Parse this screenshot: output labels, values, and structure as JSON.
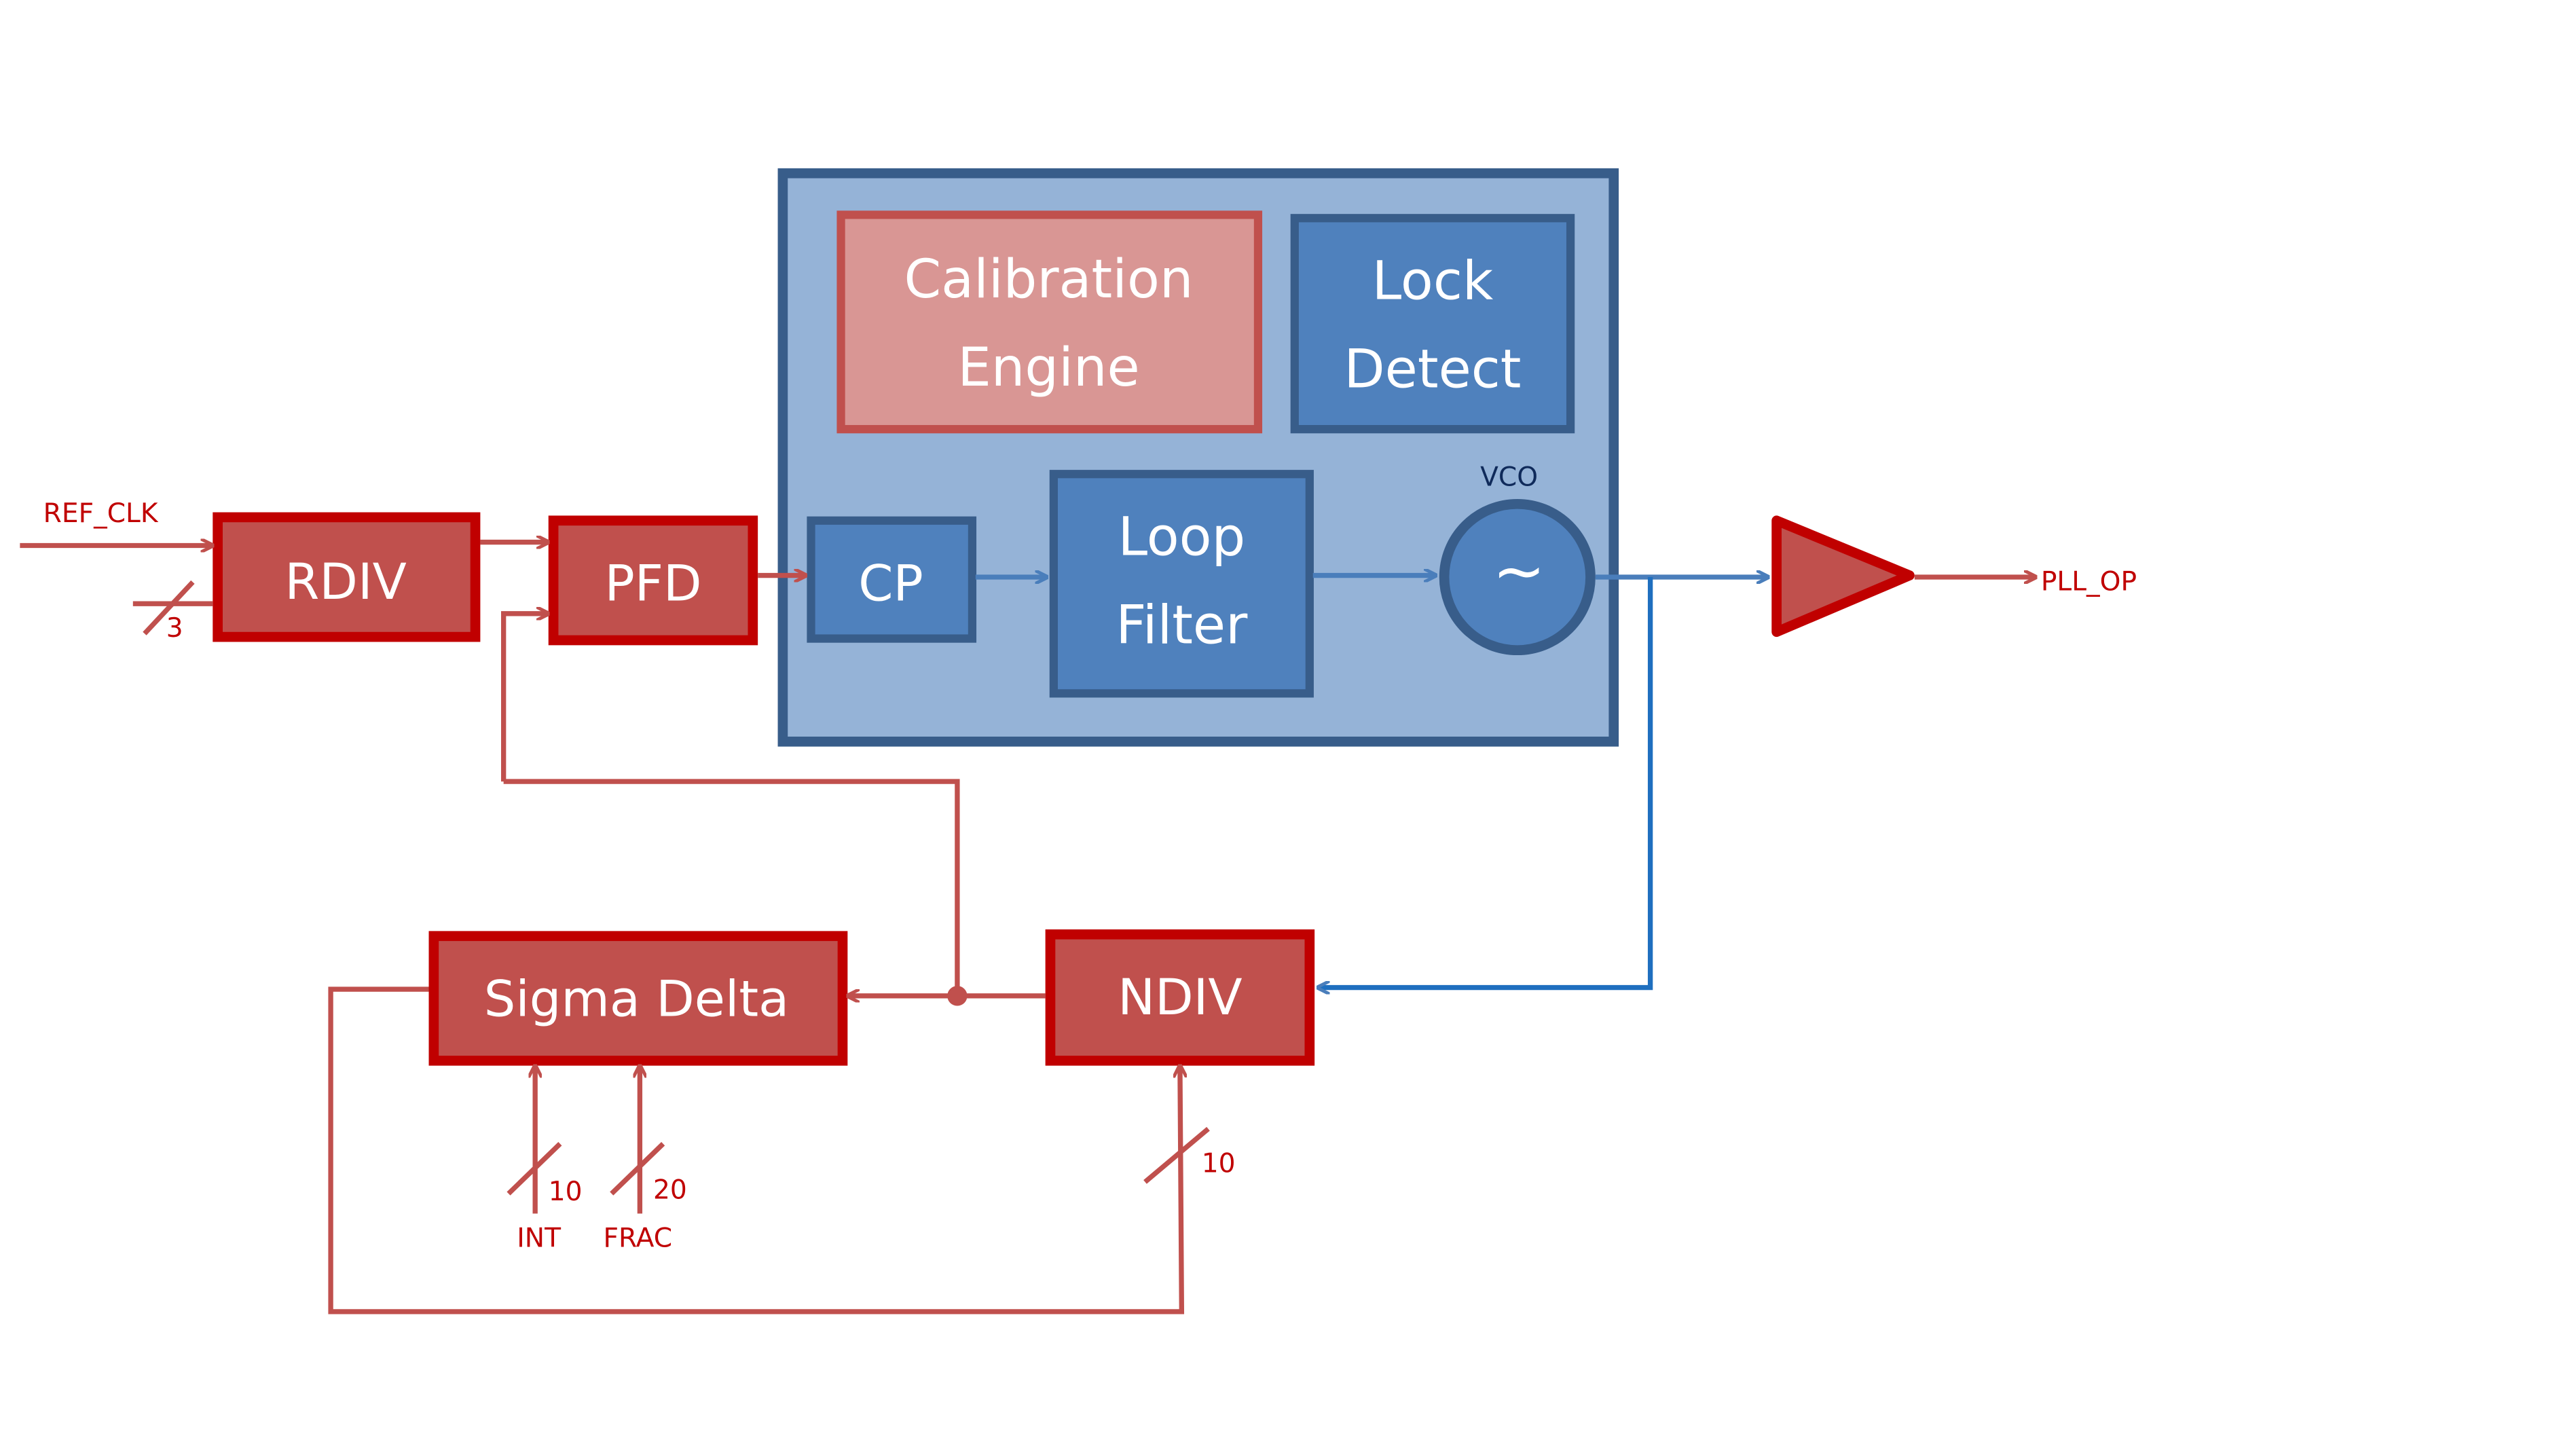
{
  "colors": {
    "red_block": "#c0504d",
    "red_border": "#c00000",
    "blue_block": "#4f81bd",
    "blue_border": "#385d8a",
    "container": "#95b3d7",
    "calibration": "#d99694",
    "wire_red": "#c0504d",
    "wire_blue": "#4a7ebb"
  },
  "blocks": {
    "rdiv": "RDIV",
    "pfd": "PFD",
    "cp": "CP",
    "loop_filter_1": "Loop",
    "loop_filter_2": "Filter",
    "calibration_1": "Calibration",
    "calibration_2": "Engine",
    "lock_1": "Lock",
    "lock_2": "Detect",
    "vco_symbol": "~",
    "vco_label": "VCO",
    "sigma_delta": "Sigma Delta",
    "ndiv": "NDIV"
  },
  "signals": {
    "ref_clk": "REF_CLK",
    "pll_op": "PLL_OP",
    "rdiv_bus": "3",
    "int_bus": "10",
    "frac_bus": "20",
    "int": "INT",
    "frac": "FRAC",
    "ndiv_bus": "10"
  }
}
